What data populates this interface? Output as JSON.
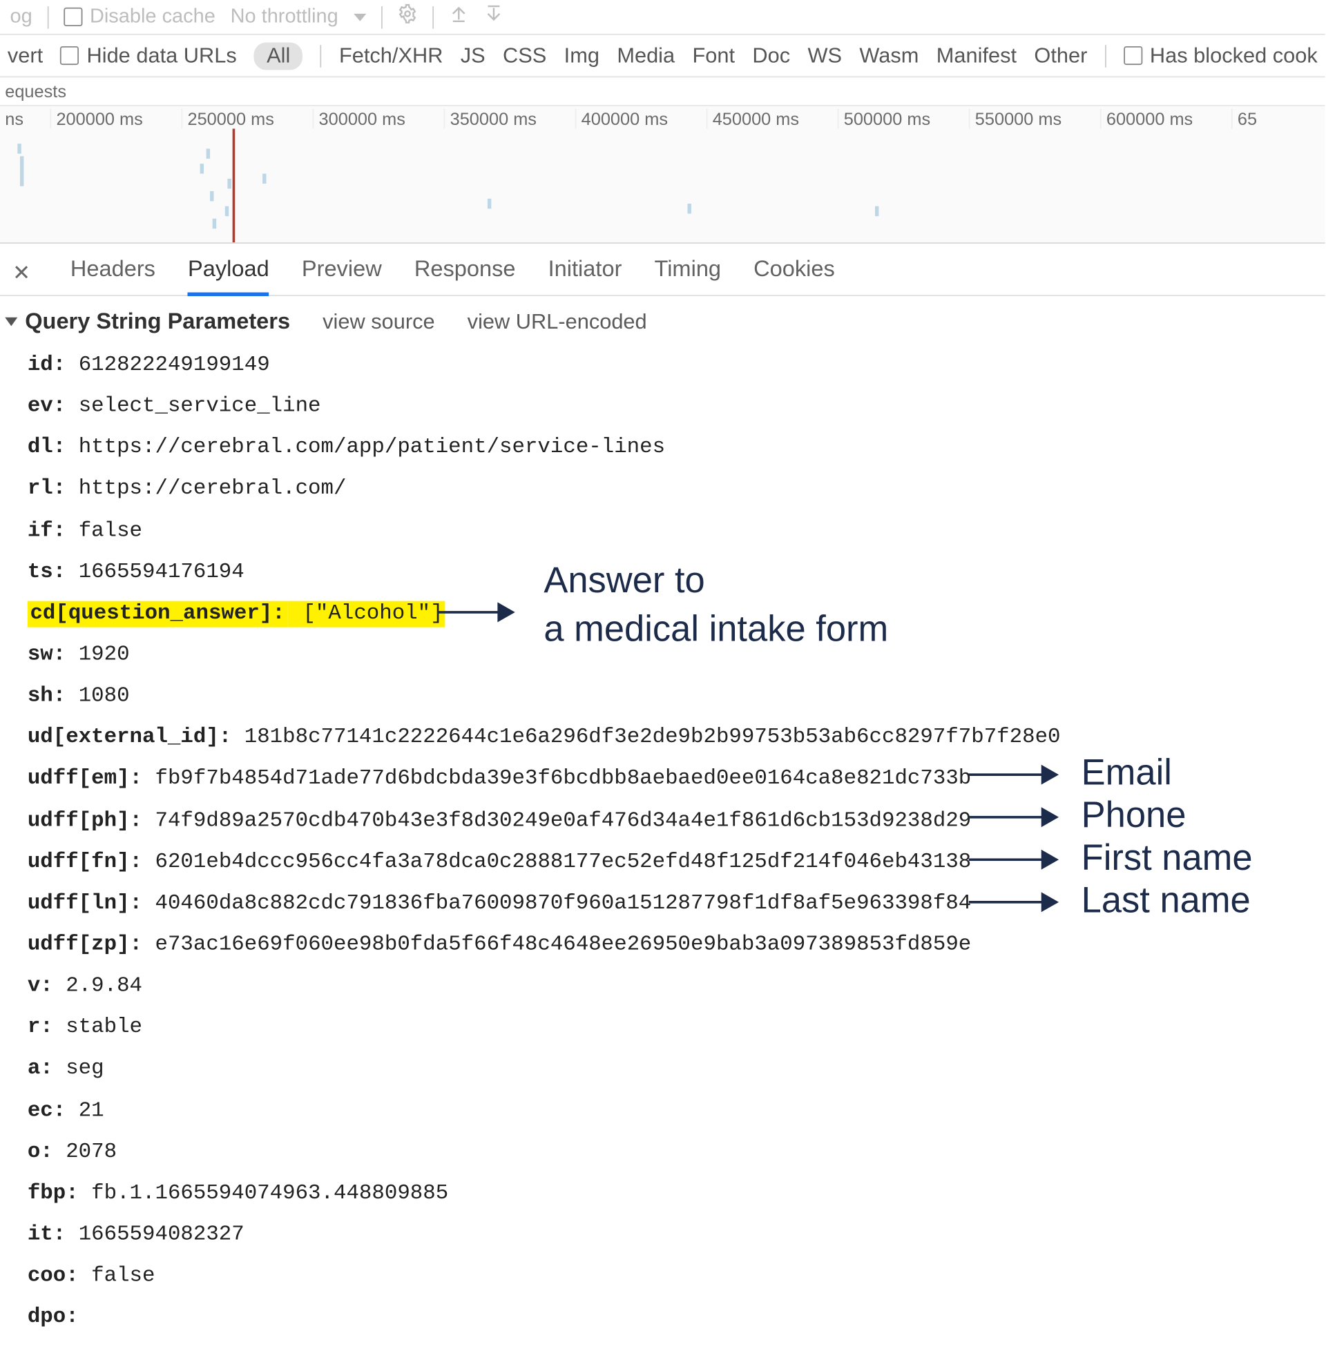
{
  "toolbar_top": {
    "trunc_left": "og",
    "disable_cache": "Disable cache",
    "throttling": "No throttling"
  },
  "filter_row": {
    "trunc_left": "vert",
    "hide_data_urls": "Hide data URLs",
    "types": [
      "All",
      "Fetch/XHR",
      "JS",
      "CSS",
      "Img",
      "Media",
      "Font",
      "Doc",
      "WS",
      "Wasm",
      "Manifest",
      "Other"
    ],
    "blocked": "Has blocked cook"
  },
  "requests_label": "equests",
  "timeline": {
    "ticks": [
      "ns",
      "200000 ms",
      "250000 ms",
      "300000 ms",
      "350000 ms",
      "400000 ms",
      "450000 ms",
      "500000 ms",
      "550000 ms",
      "600000 ms",
      "65"
    ]
  },
  "tabs": {
    "items": [
      "Headers",
      "Payload",
      "Preview",
      "Response",
      "Initiator",
      "Timing",
      "Cookies"
    ],
    "active_index": 1
  },
  "section": {
    "title": "Query String Parameters",
    "view_source": "view source",
    "view_url_encoded": "view URL-encoded"
  },
  "params": [
    {
      "k": "id:",
      "v": " 612822249199149"
    },
    {
      "k": "ev:",
      "v": " select_service_line"
    },
    {
      "k": "dl:",
      "v": " https://cerebral.com/app/patient/service-lines"
    },
    {
      "k": "rl:",
      "v": " https://cerebral.com/"
    },
    {
      "k": "if:",
      "v": " false"
    },
    {
      "k": "ts:",
      "v": " 1665594176194"
    },
    {
      "k": "cd[question_answer]:",
      "v": " [\"Alcohol\"]",
      "hl": "single"
    },
    {
      "k": "sw:",
      "v": " 1920"
    },
    {
      "k": "sh:",
      "v": " 1080"
    },
    {
      "k": "ud[external_id]:",
      "v": " 181b8c77141c2222644c1e6a296df3e2de9b2b99753b53ab6cc8297f7b7f28e0"
    },
    {
      "k": "udff[em]:",
      "v": " fb9f7b4854d71ade77d6bdcbda39e3f6bcdbb8aebaed0ee0164ca8e821dc733b",
      "hl": "row"
    },
    {
      "k": "udff[ph]:",
      "v": " 74f9d89a2570cdb470b43e3f8d30249e0af476d34a4e1f861d6cb153d9238d29",
      "hl": "row"
    },
    {
      "k": "udff[fn]:",
      "v": " 6201eb4dccc956cc4fa3a78dca0c2888177ec52efd48f125df214f046eb43138",
      "hl": "row"
    },
    {
      "k": "udff[ln]:",
      "v": " 40460da8c882cdc791836fba76009870f960a151287798f1df8af5e963398f84",
      "hl": "row"
    },
    {
      "k": "udff[zp]:",
      "v": " e73ac16e69f060ee98b0fda5f66f48c4648ee26950e9bab3a097389853fd859e"
    },
    {
      "k": "v:",
      "v": " 2.9.84"
    },
    {
      "k": "r:",
      "v": " stable"
    },
    {
      "k": "a:",
      "v": " seg"
    },
    {
      "k": "ec:",
      "v": " 21"
    },
    {
      "k": "o:",
      "v": " 2078"
    },
    {
      "k": "fbp:",
      "v": " fb.1.1665594074963.448809885"
    },
    {
      "k": "it:",
      "v": " 1665594082327"
    },
    {
      "k": "coo:",
      "v": " false"
    },
    {
      "k": "dpo:",
      "v": ""
    }
  ],
  "annotations": {
    "intake": "Answer to\na medical intake form",
    "email": "Email",
    "phone": "Phone",
    "first_name": "First name",
    "last_name": "Last name"
  }
}
